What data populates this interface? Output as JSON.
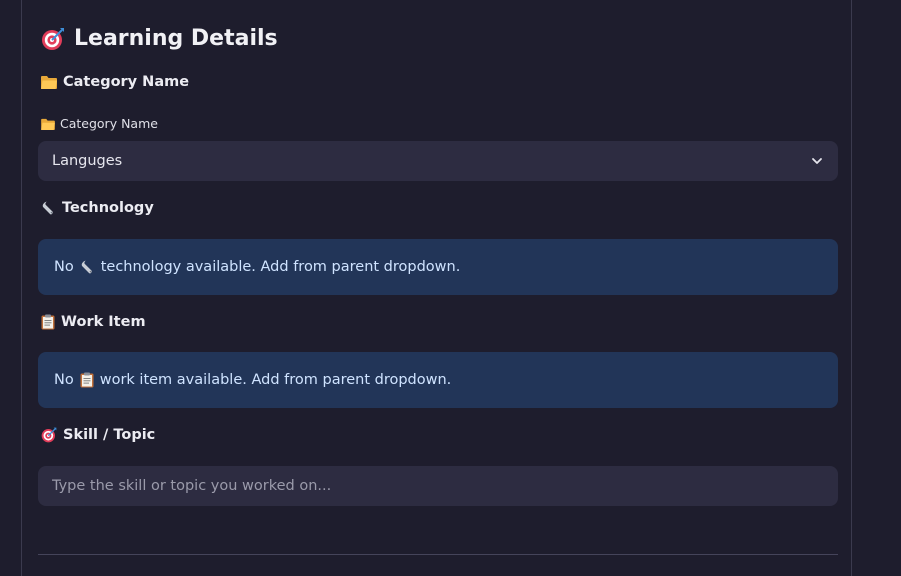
{
  "section": {
    "title": "Learning Details",
    "icon": "target-icon"
  },
  "category": {
    "heading": "Category Name",
    "field_label": "Category Name",
    "selected_value": "Languges",
    "icon": "folder-icon"
  },
  "technology": {
    "heading": "Technology",
    "icon": "wrench-icon",
    "info_prefix": "No",
    "info_suffix": "technology available. Add from parent dropdown."
  },
  "work_item": {
    "heading": "Work Item",
    "icon": "clipboard-icon",
    "info_prefix": "No",
    "info_suffix": "work item available. Add from parent dropdown."
  },
  "skill": {
    "heading": "Skill / Topic",
    "icon": "target-icon",
    "placeholder": "Type the skill or topic you worked on...",
    "value": ""
  },
  "colors": {
    "background": "#1e1d2d",
    "input_bg": "#2d2c41",
    "info_bg": "#223558",
    "info_text": "#cfe3ff"
  }
}
